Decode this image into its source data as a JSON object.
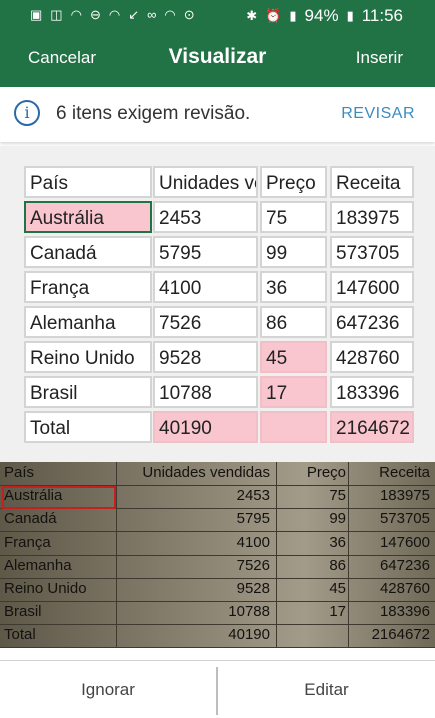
{
  "status_bar": {
    "battery": "94%",
    "time": "11:56",
    "left_icons": [
      "sim-icon",
      "outlook-icon",
      "wifi-icon",
      "dnd-icon",
      "wifi-icon",
      "missed-call-icon",
      "voicemail-icon",
      "wifi-icon",
      "location-icon"
    ],
    "right_icons": [
      "bluetooth-icon",
      "alarm-icon",
      "lte-signal-icon",
      "battery-icon"
    ]
  },
  "app_bar": {
    "cancel": "Cancelar",
    "title": "Visualizar",
    "insert": "Inserir"
  },
  "notice": {
    "icon": "info-icon",
    "message": "6 itens exigem revisão.",
    "action": "REVISAR"
  },
  "table": {
    "headers": [
      "País",
      "Unidades vendidas",
      "Preço",
      "Receita"
    ],
    "rows": [
      [
        "Austrália",
        "2453",
        "75",
        "183975"
      ],
      [
        "Canadá",
        "5795",
        "99",
        "573705"
      ],
      [
        "França",
        "4100",
        "36",
        "147600"
      ],
      [
        "Alemanha",
        "7526",
        "86",
        "647236"
      ],
      [
        "Reino Unido",
        "9528",
        "45",
        "428760"
      ],
      [
        "Brasil",
        "10788",
        "17",
        "183396"
      ],
      [
        "Total",
        "40190",
        "",
        "2164672"
      ]
    ],
    "flagged_cells": [
      [
        0,
        0
      ],
      [
        4,
        2
      ],
      [
        5,
        2
      ],
      [
        6,
        1
      ],
      [
        6,
        2
      ],
      [
        6,
        3
      ]
    ],
    "selected_cell": [
      0,
      0
    ]
  },
  "photo": {
    "headers": [
      "País",
      "Unidades vendidas",
      "Preço",
      "Receita"
    ],
    "rows": [
      [
        "Austrália",
        "2453",
        "75",
        "183975"
      ],
      [
        "Canadá",
        "5795",
        "99",
        "573705"
      ],
      [
        "França",
        "4100",
        "36",
        "147600"
      ],
      [
        "Alemanha",
        "7526",
        "86",
        "647236"
      ],
      [
        "Reino Unido",
        "9528",
        "45",
        "428760"
      ],
      [
        "Brasil",
        "10788",
        "17",
        "183396"
      ],
      [
        "Total",
        "40190",
        "",
        "2164672"
      ]
    ]
  },
  "bottom_bar": {
    "ignore": "Ignorar",
    "edit": "Editar"
  },
  "colors": {
    "brand": "#217346",
    "flag": "#f9c5ce",
    "link": "#3a8bbf",
    "highlight_box": "#c42020"
  }
}
